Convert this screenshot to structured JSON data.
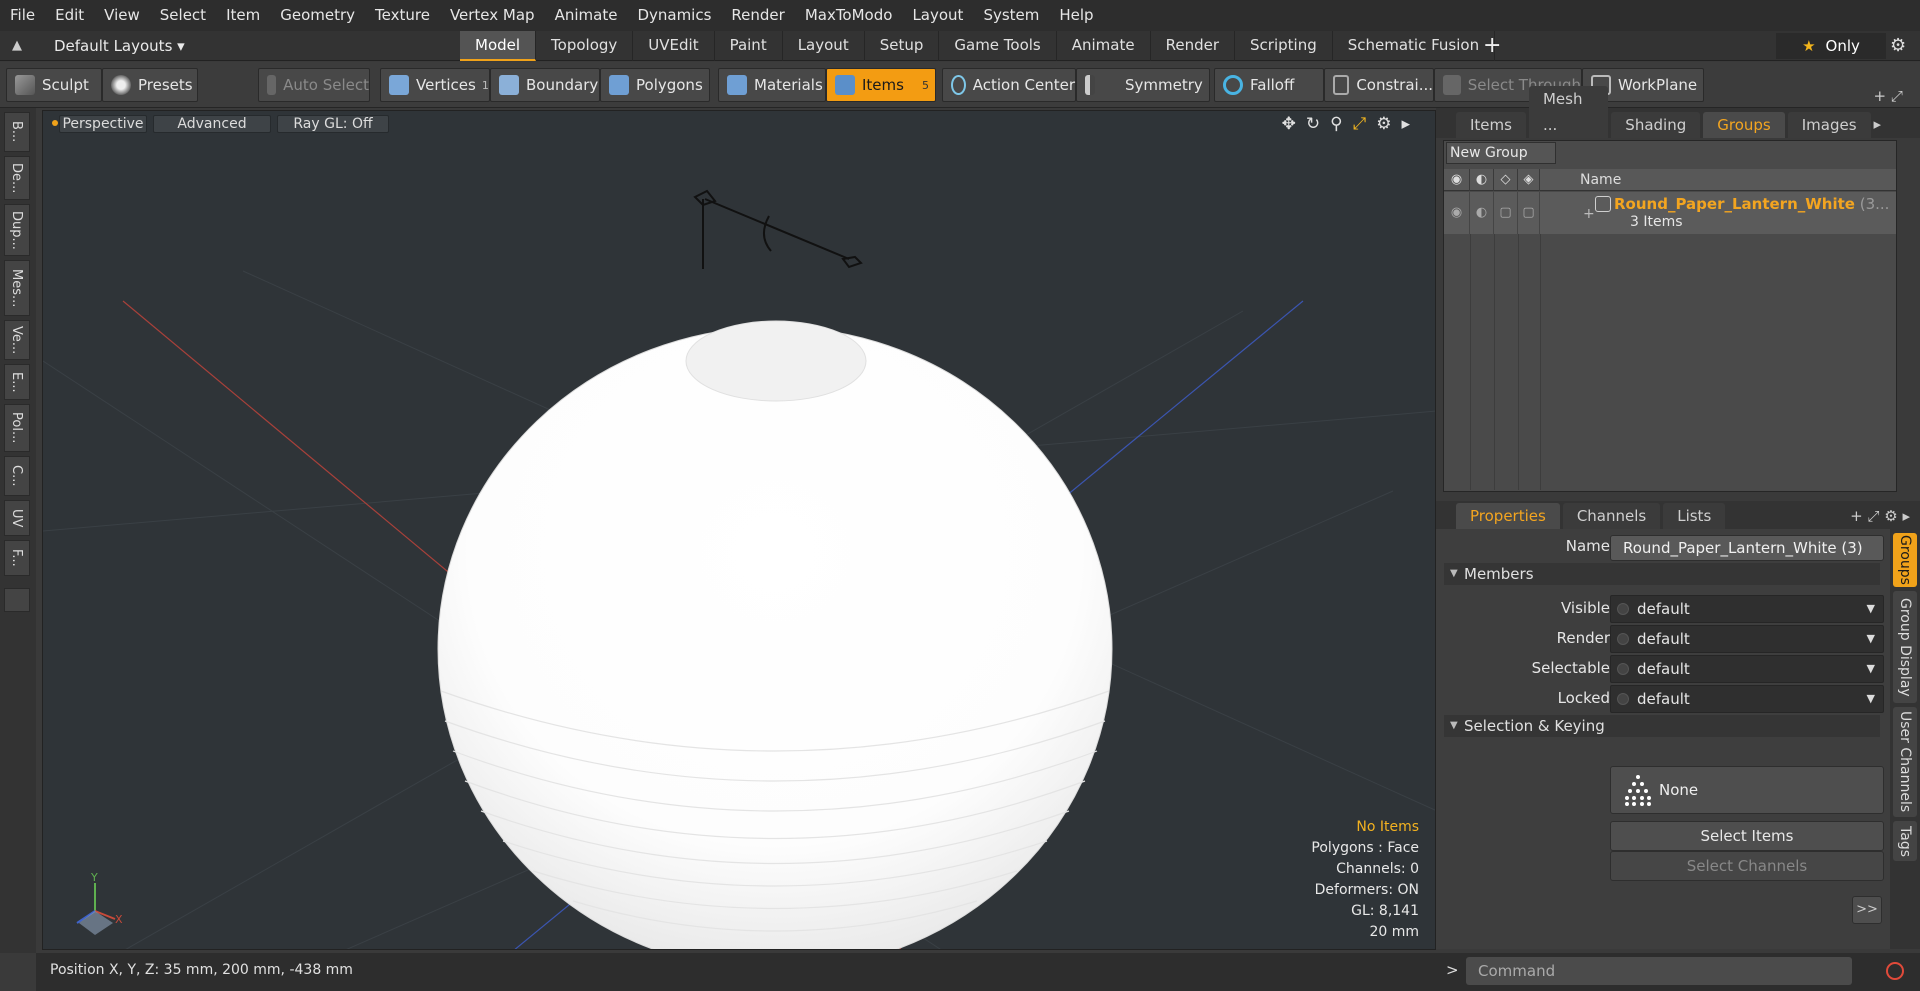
{
  "menubar": [
    "File",
    "Edit",
    "View",
    "Select",
    "Item",
    "Geometry",
    "Texture",
    "Vertex Map",
    "Animate",
    "Dynamics",
    "Render",
    "MaxToModo",
    "Layout",
    "System",
    "Help"
  ],
  "layouts": {
    "selector": "Default Layouts ▾",
    "tabs": [
      "Model",
      "Topology",
      "UVEdit",
      "Paint",
      "Layout",
      "Setup",
      "Game Tools",
      "Animate",
      "Render",
      "Scripting",
      "Schematic Fusion"
    ],
    "active_tab": "Model",
    "only_label": "Only"
  },
  "toolbar": {
    "sculpt": "Sculpt",
    "presets": "Presets",
    "auto_select": "Auto Select",
    "vertices": "Vertices",
    "vertices_count": "1",
    "boundary": "Boundary",
    "polygons": "Polygons",
    "materials": "Materials",
    "items": "Items",
    "items_count": "5",
    "action_center": "Action Center",
    "symmetry": "Symmetry",
    "falloff": "Falloff",
    "constraints": "Constrai...",
    "select_through": "Select Through",
    "workplane": "WorkPlane"
  },
  "left_strip": [
    "B...",
    "De...",
    "Dup...",
    "Mes...",
    "Ve...",
    "E...",
    "Pol...",
    "C...",
    "UV",
    "F..."
  ],
  "viewport": {
    "view_mode": "Perspective",
    "shading": "Advanced",
    "raygl": "Ray GL: Off",
    "info": {
      "selection": "No Items",
      "polygons": "Polygons : Face",
      "channels": "Channels: 0",
      "deformers": "Deformers: ON",
      "gl": "GL: 8,141",
      "grid": "20 mm"
    }
  },
  "status": {
    "position": "Position X, Y, Z:  35 mm, 200 mm, -438 mm",
    "command_placeholder": "Command"
  },
  "groups_panel": {
    "tabs": [
      "Items",
      "Mesh ...",
      "Shading",
      "Groups",
      "Images"
    ],
    "active_tab": "Groups",
    "new_group": "New Group",
    "col_name": "Name",
    "group_name": "Round_Paper_Lantern_White",
    "group_count": " (3...",
    "group_items": "3 Items"
  },
  "properties_panel": {
    "tabs": [
      "Properties",
      "Channels",
      "Lists"
    ],
    "active_tab": "Properties",
    "name_label": "Name",
    "name_value": "Round_Paper_Lantern_White (3)",
    "members_section": "Members",
    "visible_label": "Visible",
    "visible_value": "default",
    "render_label": "Render",
    "render_value": "default",
    "selectable_label": "Selectable",
    "selectable_value": "default",
    "locked_label": "Locked",
    "locked_value": "default",
    "keying_section": "Selection & Keying",
    "keying_value": "None",
    "select_items": "Select Items",
    "select_channels": "Select Channels",
    "more": ">>",
    "side_tabs": [
      "Groups",
      "Group Display",
      "User Channels",
      "Tags"
    ]
  },
  "colors": {
    "accent": "#f39c12",
    "viewport_bg": "#2f3438",
    "highlight_text": "#f3a520"
  }
}
